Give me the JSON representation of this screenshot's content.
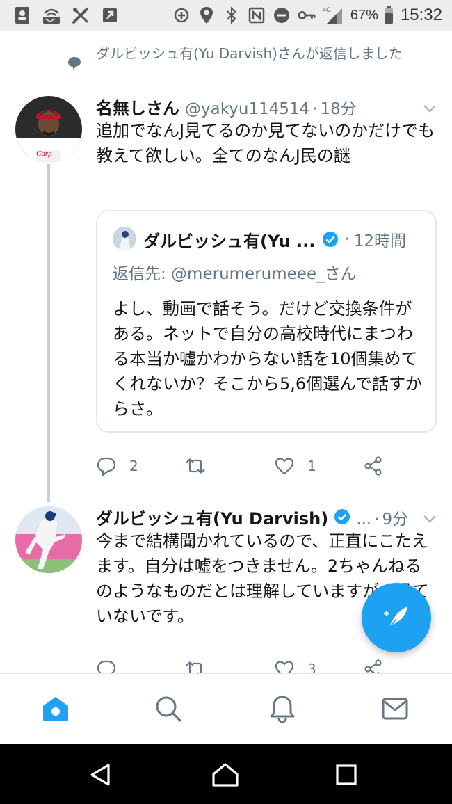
{
  "status_bar": {
    "network": "4G",
    "battery": "67%",
    "time": "15:32"
  },
  "retweet_note": "ダルビッシュ有(Yu Darvish)さんが返信しました",
  "tweet1": {
    "name": "名無しさん",
    "handle": "@yakyu114514",
    "dot": "·",
    "time": "18分",
    "text": "追加でなんJ見てるのか見てないのかだけでも教えて欲しい。全てのなんJ民の謎",
    "quote": {
      "name": "ダルビッシュ有(Yu ...",
      "dot": "·",
      "time": "12時間",
      "reply_to": "返信先: @merumerumeee_さん",
      "text": "よし、動画で話そう。だけど交換条件がある。ネットで自分の高校時代にまつわる本当か嘘かわからない話を10個集めてくれないか？そこから5,6個選んで話すからさ。"
    },
    "actions": {
      "reply_count": "2",
      "retweet_count": "",
      "like_count": "1"
    }
  },
  "tweet2": {
    "name": "ダルビッシュ有(Yu Darvish)",
    "ellipsis": "...",
    "dot": "·",
    "time": "9分",
    "text": "今まで結構聞かれているので、正直にこたえます。自分は嘘をつきません。2ちゃんねるのようなものだとは理解していますが、見ていないです。",
    "actions": {
      "reply_count": "",
      "retweet_count": "",
      "like_count": "3"
    }
  },
  "colors": {
    "accent": "#1da1f2",
    "secondary_text": "#657786",
    "thread_line": "#c4cfd6"
  },
  "tabs": [
    "home-icon",
    "search-icon",
    "notifications-icon",
    "messages-icon"
  ]
}
